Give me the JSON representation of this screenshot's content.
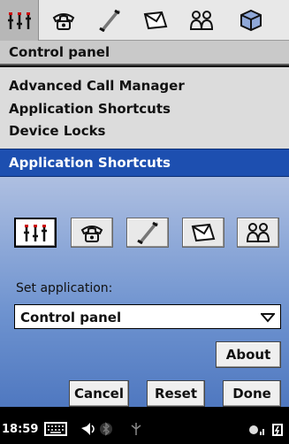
{
  "tabs": [
    {
      "name": "control-panel",
      "icon": "sliders-icon",
      "active": true
    },
    {
      "name": "phone",
      "icon": "phone-icon",
      "active": false
    },
    {
      "name": "calls",
      "icon": "handset-icon",
      "active": false
    },
    {
      "name": "messages",
      "icon": "envelope-icon",
      "active": false
    },
    {
      "name": "contacts",
      "icon": "people-icon",
      "active": false
    },
    {
      "name": "applications",
      "icon": "cube-icon",
      "active": false
    }
  ],
  "title": "Control panel",
  "list": [
    "Advanced Call Manager",
    "Application Shortcuts",
    "Device Locks"
  ],
  "dialog": {
    "title": "Application Shortcuts",
    "app_buttons": [
      "sliders-icon",
      "phone-icon",
      "handset-icon",
      "envelope-icon",
      "people-icon"
    ],
    "selected_button": 0,
    "set_label": "Set application:",
    "selected_app": "Control panel",
    "about_label": "About",
    "cancel_label": "Cancel",
    "reset_label": "Reset",
    "done_label": "Done"
  },
  "status": {
    "time": "18:59",
    "icons": [
      "keyboard-icon",
      "volume-icon",
      "bluetooth-icon",
      "antenna-icon",
      "signal-icon",
      "battery-icon"
    ]
  },
  "colors": {
    "dialog_title": "#1d4fb0",
    "dialog_body": "#5a83c4",
    "tab_active": "#b7b7b7"
  }
}
